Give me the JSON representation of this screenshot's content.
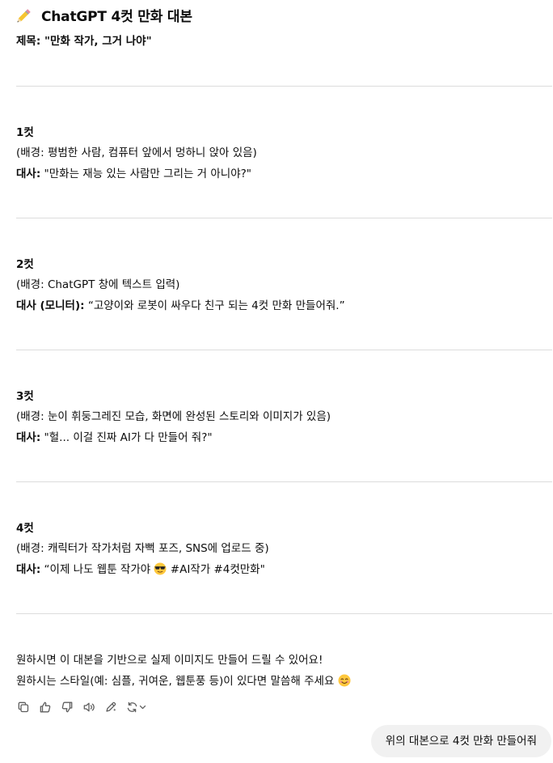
{
  "heading": {
    "icon": "pencil-icon",
    "text": "ChatGPT 4컷 만화 대본"
  },
  "title_line": {
    "label": "제목:",
    "value": " \"만화 작가, 그거 나야\""
  },
  "panels": [
    {
      "title": "1컷",
      "background": "(배경: 평범한 사람, 컴퓨터 앞에서 멍하니 앉아 있음)",
      "dialogue_label": "대사:",
      "dialogue": " \"만화는 재능 있는 사람만 그리는 거 아니야?\""
    },
    {
      "title": "2컷",
      "background": "(배경: ChatGPT 창에 텍스트 입력)",
      "dialogue_label": "대사 (모니터):",
      "dialogue": " “고양이와 로봇이 싸우다 친구 되는 4컷 만화 만들어줘.”"
    },
    {
      "title": "3컷",
      "background": "(배경: 눈이 휘둥그레진 모습, 화면에 완성된 스토리와 이미지가 있음)",
      "dialogue_label": "대사:",
      "dialogue": " \"헐... 이걸 진짜 AI가 다 만들어 줘?\""
    },
    {
      "title": "4컷",
      "background": "(배경: 캐릭터가 작가처럼 자뻑 포즈, SNS에 업로드 중)",
      "dialogue_label": "대사:",
      "dialogue_a": " “이제 나도 웹툰 작가야 ",
      "dialogue_emoji": "sunglasses-emoji",
      "dialogue_b": " #AI작가 #4컷만화\""
    }
  ],
  "closing": {
    "line1": "원하시면 이 대본을 기반으로 실제 이미지도 만들어 드릴 수 있어요!",
    "line2": "원하시는 스타일(예: 심플, 귀여운, 웹툰풍 등)이 있다면 말씀해 주세요 ",
    "line2_emoji": "smiling-emoji"
  },
  "toolbar": [
    "copy-icon",
    "thumbs-up-icon",
    "thumbs-down-icon",
    "read-aloud-icon",
    "edit-icon",
    "regenerate-icon"
  ],
  "user_message": "위의 대본으로 4컷 만화 만들어줘",
  "colors": {
    "text": "#0d0d0d",
    "divider": "#dcdcdc",
    "bubble": "#f1f1f1",
    "icon": "#5d5d5d"
  }
}
